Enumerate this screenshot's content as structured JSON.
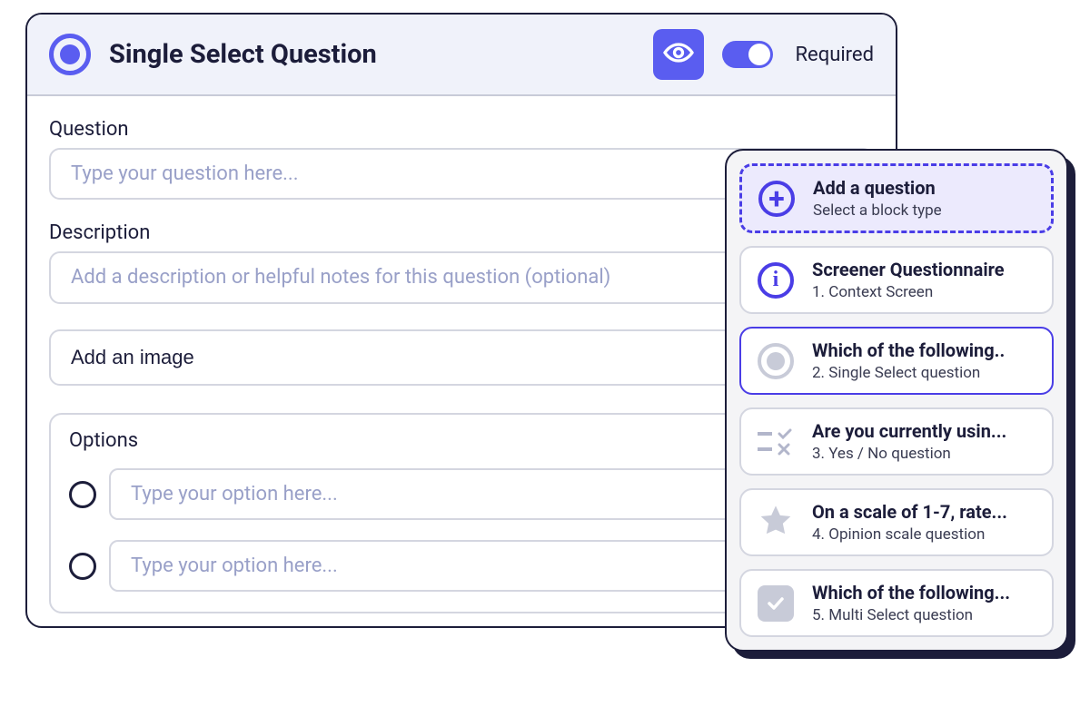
{
  "editor": {
    "title": "Single Select Question",
    "required_label": "Required",
    "question_label": "Question",
    "question_placeholder": "Type your question here...",
    "description_label": "Description",
    "description_placeholder": "Add a description or helpful notes for this question (optional)",
    "image_button_label": "Add an image",
    "options_label": "Options",
    "option_placeholder": "Type your option here..."
  },
  "sidebar": {
    "add": {
      "title": "Add a question",
      "sub": "Select a block type"
    },
    "items": [
      {
        "title": "Screener Questionnaire",
        "sub": "1. Context Screen"
      },
      {
        "title": "Which of the following..",
        "sub": "2. Single Select question"
      },
      {
        "title": "Are you currently usin...",
        "sub": "3. Yes / No question"
      },
      {
        "title": "On a scale of 1-7, rate...",
        "sub": "4. Opinion scale question"
      },
      {
        "title": "Which of the following...",
        "sub": "5. Multi Select question"
      }
    ]
  }
}
